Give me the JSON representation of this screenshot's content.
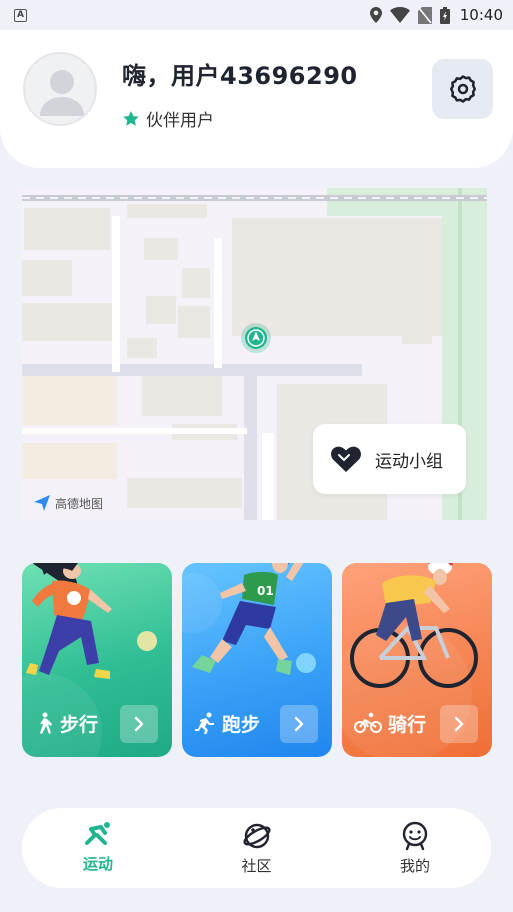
{
  "status_bar": {
    "left_badge": "A",
    "time": "10:40",
    "icons": [
      "location-icon",
      "wifi-icon",
      "no-sim-icon",
      "battery-icon"
    ]
  },
  "profile": {
    "username": "嗨，用户43696290",
    "level": "伙伴用户",
    "avatar_icon": "default-avatar-icon",
    "settings_icon": "gear-icon"
  },
  "map": {
    "watermark": "高德地图",
    "sport_group_label": "运动小组",
    "sport_group_icon": "heart-icon",
    "location_icon": "location-arrow-icon"
  },
  "sports": [
    {
      "label": "步行",
      "icon": "walking-icon"
    },
    {
      "label": "跑步",
      "icon": "running-icon"
    },
    {
      "label": "骑行",
      "icon": "cycling-icon"
    }
  ],
  "bottom_nav": {
    "items": [
      {
        "label": "运动",
        "icon": "sport-icon",
        "active": true
      },
      {
        "label": "社区",
        "icon": "planet-icon",
        "active": false
      },
      {
        "label": "我的",
        "icon": "profile-face-icon",
        "active": false
      }
    ]
  },
  "colors": {
    "accent": "#21b590",
    "background": "#eef2f8",
    "walk_card": "#2fbd94",
    "run_card": "#3aa1f7",
    "ride_card": "#f58452"
  }
}
